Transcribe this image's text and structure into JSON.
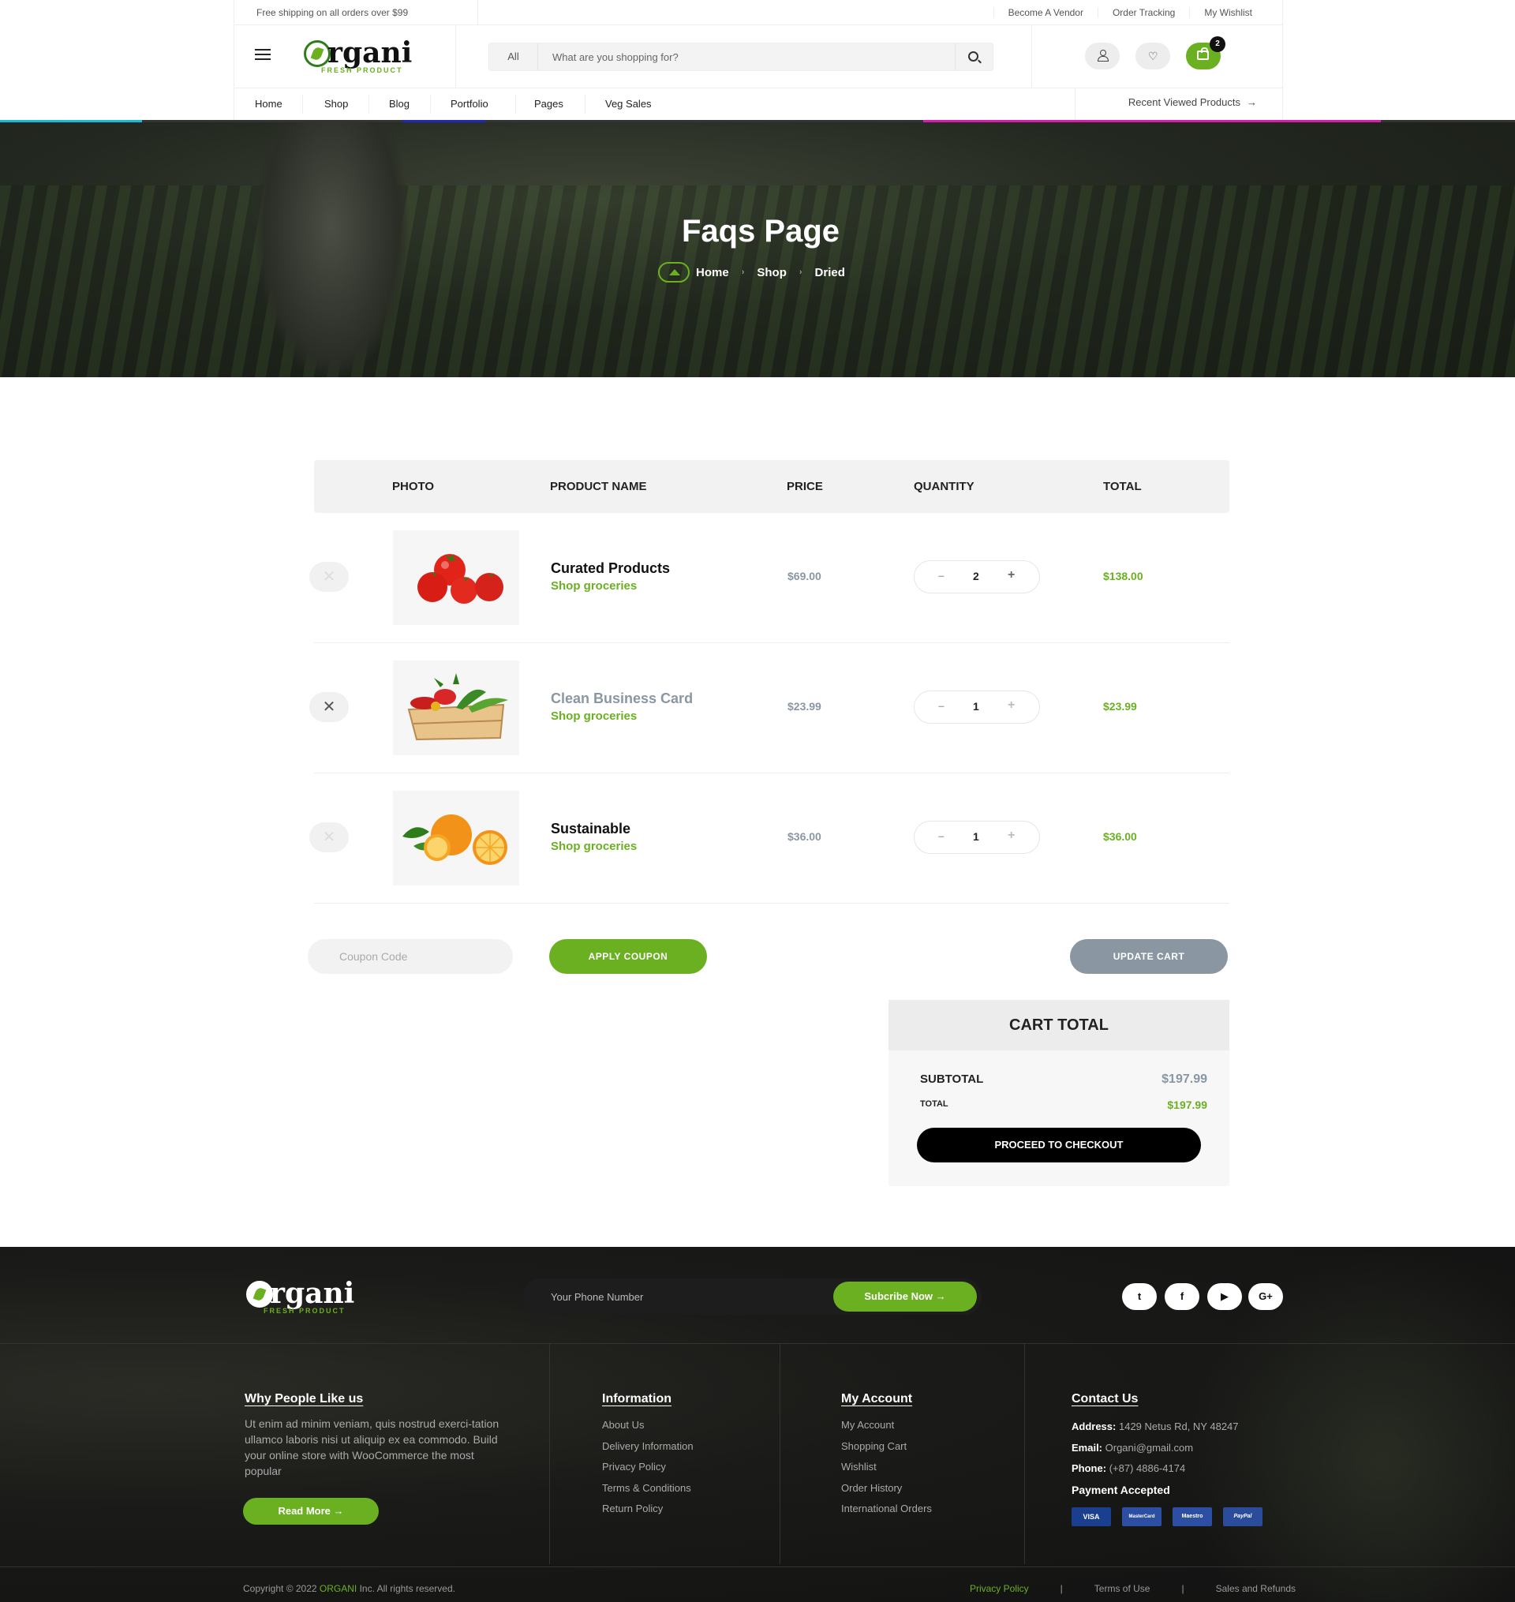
{
  "topbar": {
    "shipping": "Free shipping on all orders over $99",
    "links": [
      "Become A Vendor",
      "Order Tracking",
      "My Wishlist"
    ]
  },
  "header": {
    "logo_word": "rgani",
    "logo_tag": "FRESH PRODUCT",
    "search_category": "All",
    "search_placeholder": "What are you shopping for?",
    "cart_count": "2"
  },
  "nav": {
    "items": [
      "Home",
      "Shop",
      "Blog",
      "Portfolio",
      "Pages",
      "Veg Sales"
    ],
    "recent": "Recent Viewed Products"
  },
  "hero": {
    "title": "Faqs Page",
    "crumbs": [
      "Home",
      "Shop",
      "Dried"
    ]
  },
  "cart": {
    "headers": [
      "PHOTO",
      "PRODUCT NAME",
      "PRICE",
      "QUANTITY",
      "TOTAL"
    ],
    "rows": [
      {
        "name": "Curated Products",
        "sub": "Shop groceries",
        "price": "$69.00",
        "qty": "2",
        "total": "$138.00",
        "image": "tomatoes"
      },
      {
        "name": "Clean Business Card",
        "sub": "Shop groceries",
        "price": "$23.99",
        "qty": "1",
        "total": "$23.99",
        "image": "vegetable-crate"
      },
      {
        "name": "Sustainable",
        "sub": "Shop groceries",
        "price": "$36.00",
        "qty": "1",
        "total": "$36.00",
        "image": "oranges"
      }
    ],
    "coupon_placeholder": "Coupon Code",
    "apply": "APPLY COUPON",
    "update": "UPDATE CART"
  },
  "totals": {
    "title": "CART TOTAL",
    "subtotal_label": "SUBTOTAL",
    "subtotal": "$197.99",
    "total_label": "TOTAL",
    "total": "$197.99",
    "checkout": "PROCEED TO CHECKOUT"
  },
  "footer": {
    "phone_placeholder": "Your Phone Number",
    "subscribe": "Subcribe Now",
    "social": [
      "twitter-icon",
      "facebook-icon",
      "youtube-icon",
      "google-plus-icon"
    ],
    "about_title": "Why People Like us",
    "about_text": "Ut enim ad minim veniam, quis nostrud exerci-tation ullamco laboris nisi ut aliquip ex ea commodo. Build your online store with WooCommerce the most popular",
    "read_more": "Read More",
    "info_title": "Information",
    "info_links": [
      "About Us",
      "Delivery Information",
      "Privacy Policy",
      "Terms & Conditions",
      "Return Policy"
    ],
    "account_title": "My Account",
    "account_links": [
      "My Account",
      "Shopping Cart",
      "Wishlist",
      "Order History",
      "International Orders"
    ],
    "contact_title": "Contact Us",
    "address_label": "Address:",
    "address": "1429 Netus Rd, NY 48247",
    "email_label": "Email:",
    "email": "Organi@gmail.com",
    "phone_label": "Phone:",
    "phone": "(+87) 4886-4174",
    "payment_title": "Payment Accepted",
    "cards": [
      "VISA",
      "MasterCard",
      "Maestro",
      "PayPal"
    ],
    "copyright_pre": "Copyright © 2022",
    "copyright_brand": "ORGANI",
    "copyright_post": "Inc. All rights reserved.",
    "bottom_links": [
      "Privacy Policy",
      "Terms of Use",
      "Sales and Refunds"
    ]
  },
  "colors": {
    "accent": "#6ab021",
    "muted": "#8a97a3",
    "dark": "#111111"
  }
}
